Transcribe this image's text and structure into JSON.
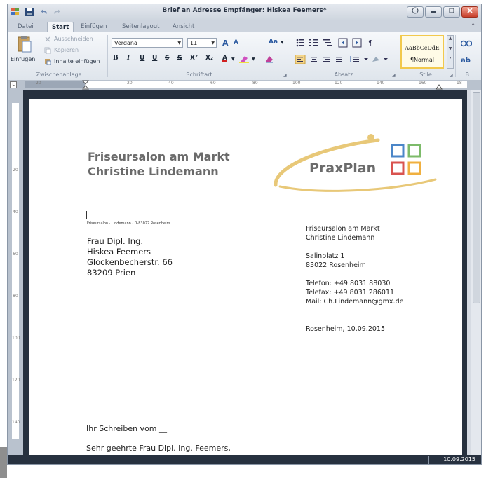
{
  "window": {
    "title": "Brief an Adresse Empfänger: Hiskea Feemers*"
  },
  "tabs": [
    {
      "label": "Datei"
    },
    {
      "label": "Start"
    },
    {
      "label": "Einfügen"
    },
    {
      "label": "Seitenlayout"
    },
    {
      "label": "Ansicht"
    }
  ],
  "ribbon": {
    "clipboard": {
      "paste_label": "Einfügen",
      "cut_label": "Ausschneiden",
      "copy_label": "Kopieren",
      "paste_content_label": "Inhalte einfügen",
      "group_label": "Zwischenablage"
    },
    "font": {
      "font_name": "Verdana",
      "font_size": "11",
      "group_label": "Schriftart"
    },
    "paragraph": {
      "group_label": "Absatz"
    },
    "styles": {
      "sample": "AaBbCcDdE",
      "current": "¶Normal",
      "group_label": "Stile",
      "more_label": "B..."
    }
  },
  "ruler": {
    "ticks": [
      "20",
      "20",
      "40",
      "60",
      "80",
      "100",
      "120",
      "140",
      "160",
      "18"
    ]
  },
  "vruler": {
    "ticks": [
      "20",
      "40",
      "60",
      "80",
      "100",
      "120",
      "140"
    ]
  },
  "document": {
    "sender_heading": [
      "Friseursalon am Markt",
      "Christine Lindemann"
    ],
    "logo_text": "PraxPlan",
    "sender_line": "Friseursalon · Lindemann · D-83022 Rosenheim",
    "recipient": [
      "Frau Dipl. Ing.",
      "Hiskea Feemers",
      "Glockenbecherstr. 66",
      "83209 Prien"
    ],
    "sender_block": {
      "name": [
        "Friseursalon am Markt",
        "Christine Lindemann"
      ],
      "address": [
        "Salinplatz  1",
        "83022 Rosenheim"
      ],
      "contact": [
        "Telefon: +49 8031 88030",
        "Telefax: +49 8031 286011",
        "Mail: Ch.Lindemann@gmx.de"
      ],
      "date_line": "Rosenheim, 10.09.2015"
    },
    "reference_line": "Ihr Schreiben vom __",
    "salutation": "Sehr geehrte Frau Dipl. Ing. Feemers,"
  },
  "status": {
    "date": "10.09.2015"
  },
  "colors": {
    "logo_green": "#7dbb6a",
    "logo_blue": "#4b86c8",
    "logo_red": "#d9534f",
    "logo_orange": "#f0b040",
    "logo_swoosh": "#e8c878"
  }
}
